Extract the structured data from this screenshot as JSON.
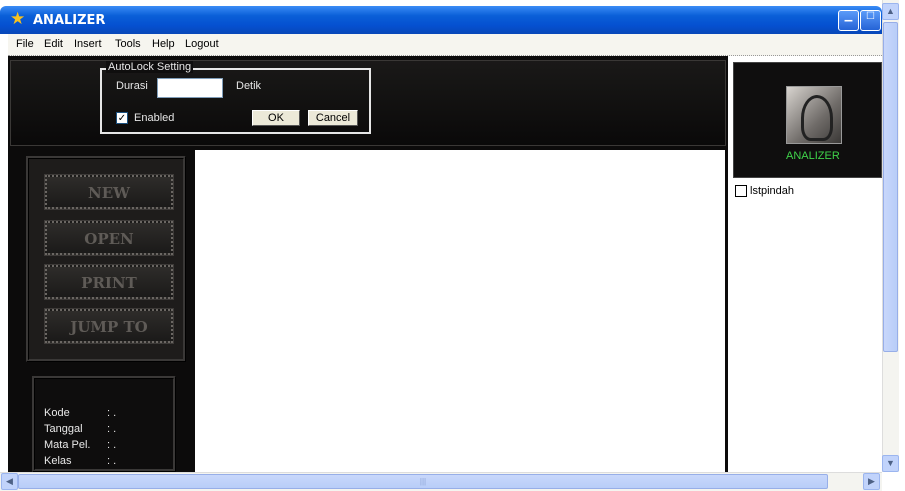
{
  "window": {
    "title": "ANALIZER"
  },
  "menu": {
    "items": [
      "File",
      "Edit",
      "Insert",
      "Tools",
      "Help",
      "Logout"
    ]
  },
  "autolock": {
    "legend": "AutoLock Setting",
    "durasi_label": "Durasi",
    "durasi_value": "",
    "unit_label": "Detik",
    "enabled_label": "Enabled",
    "enabled_checked": true,
    "ok_label": "OK",
    "cancel_label": "Cancel"
  },
  "nav": {
    "new": "NEW",
    "open": "OPEN",
    "print": "PRINT",
    "jump": "JUMP TO"
  },
  "info": {
    "rows": [
      {
        "label": "Kode",
        "value": ": ."
      },
      {
        "label": "Tanggal",
        "value": ": ."
      },
      {
        "label": "Mata Pel.",
        "value": ": ."
      },
      {
        "label": "Kelas",
        "value": ": ."
      }
    ]
  },
  "right": {
    "app_label": "ANALIZER",
    "list_item": "lstpindah"
  },
  "icons": {
    "title": "star-icon"
  },
  "colors": {
    "titlebar": "#0a5fd8",
    "accent_green": "#3fd44a",
    "dark_bg": "#0c0b0b"
  }
}
